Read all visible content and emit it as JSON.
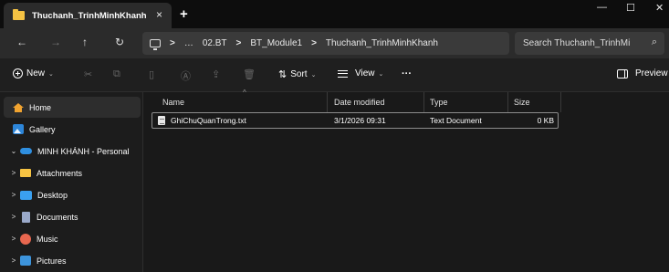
{
  "tab": {
    "title": "Thuchanh_TrinhMinhKhanh",
    "close": "×",
    "new_tab": "+"
  },
  "window_controls": {
    "minimize": "—",
    "maximize": "☐",
    "close": "✕"
  },
  "nav": {
    "back": "←",
    "forward": "→",
    "up": "↑",
    "refresh": "↻"
  },
  "address": {
    "more": "…",
    "separators": [
      ">",
      ">",
      ">",
      ">"
    ],
    "crumbs": [
      "02.BT",
      "BT_Module1",
      "Thuchanh_TrinhMinhKhanh"
    ]
  },
  "search": {
    "placeholder": "Search Thuchanh_TrinhMi",
    "icon": "search-icon"
  },
  "toolbar": {
    "new_label": "New",
    "sort_label": "Sort",
    "view_label": "View",
    "more_label": "···",
    "preview_label": "Preview",
    "dropdown": "⌄",
    "disabled_icons": [
      "cut-icon",
      "copy-icon",
      "paste-icon",
      "rename-icon",
      "share-icon",
      "delete-icon"
    ]
  },
  "sidebar": {
    "items": [
      {
        "label": "Home",
        "icon": "home-icon",
        "selected": true
      },
      {
        "label": "Gallery",
        "icon": "gallery-icon"
      },
      {
        "label": "MINH KHÁNH - Personal",
        "icon": "onedrive-icon",
        "caret": "⌄"
      },
      {
        "label": "Attachments",
        "icon": "folder-icon",
        "caret": ">"
      },
      {
        "label": "Desktop",
        "icon": "desktop-icon",
        "caret": ">"
      },
      {
        "label": "Documents",
        "icon": "documents-icon",
        "caret": ">"
      },
      {
        "label": "Music",
        "icon": "music-icon",
        "caret": ">"
      },
      {
        "label": "Pictures",
        "icon": "pictures-icon",
        "caret": ">"
      }
    ]
  },
  "table": {
    "columns": [
      "Name",
      "Date modified",
      "Type",
      "Size"
    ],
    "sort_indicator": "^",
    "rows": [
      {
        "name": "GhiChuQuanTrong.txt",
        "date": "3/1/2026 09:31",
        "type": "Text Document",
        "size": "0 KB"
      }
    ]
  },
  "colors": {
    "background": "#191919",
    "tab_strip": "#0d0d0d",
    "accent_folder": "#f6c343",
    "selection_border": "#8c8c8c"
  }
}
